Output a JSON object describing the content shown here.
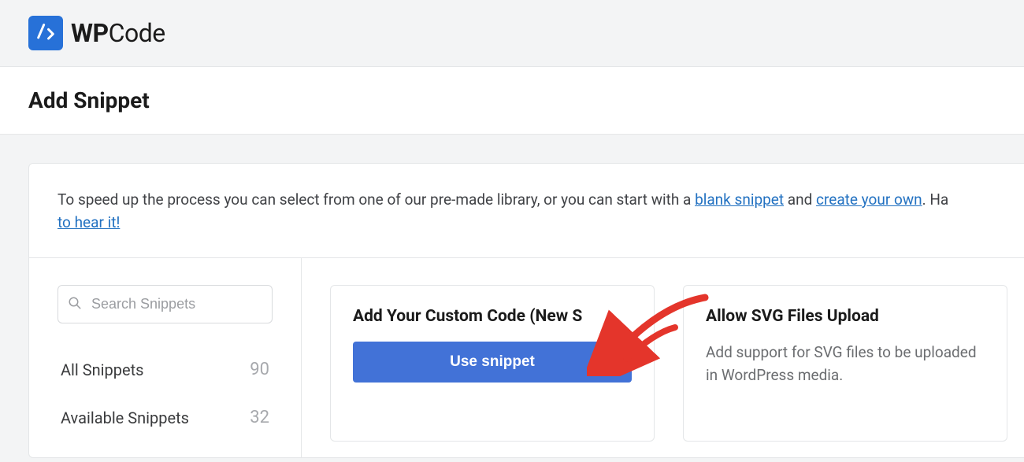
{
  "brand": {
    "prefix": "WP",
    "suffix": "Code"
  },
  "page": {
    "title": "Add Snippet"
  },
  "intro": {
    "part1": "To speed up the process you can select from one of our pre-made library, or you can start with a ",
    "link1": "blank snippet",
    "part2": " and ",
    "link2": "create your own",
    "part3": ". Ha",
    "link3": "to hear it!"
  },
  "sidebar": {
    "search_placeholder": "Search Snippets",
    "categories": [
      {
        "label": "All Snippets",
        "count": "90"
      },
      {
        "label": "Available Snippets",
        "count": "32"
      }
    ]
  },
  "cards": [
    {
      "title": "Add Your Custom Code (New S",
      "button": "Use snippet"
    },
    {
      "title": "Allow SVG Files Upload",
      "desc": "Add support for SVG files to be uploaded in WordPress media."
    }
  ]
}
